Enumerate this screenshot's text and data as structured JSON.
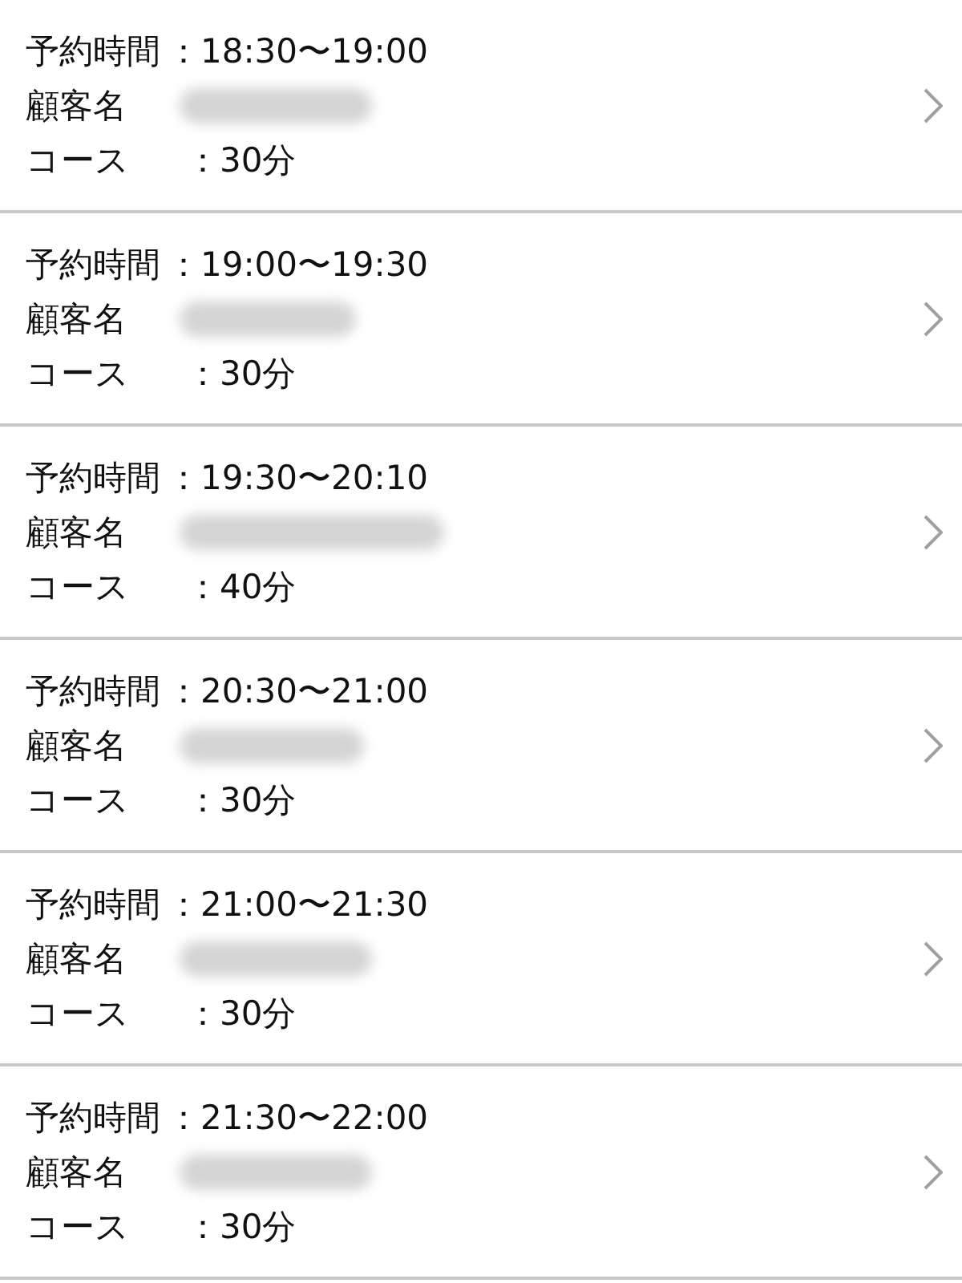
{
  "reservations": [
    {
      "time_label": "予約時間",
      "time": "：18:30〜19:00",
      "customer_label": "顧客名",
      "course_label": "コース",
      "course": "：30分"
    },
    {
      "time_label": "予約時間",
      "time": "：19:00〜19:30",
      "customer_label": "顧客名",
      "course_label": "コース",
      "course": "：30分"
    },
    {
      "time_label": "予約時間",
      "time": "：19:30〜20:10",
      "customer_label": "顧客名",
      "course_label": "コース",
      "course": "：40分"
    },
    {
      "time_label": "予約時間",
      "time": "：20:30〜21:00",
      "customer_label": "顧客名",
      "course_label": "コース",
      "course": "：30分"
    },
    {
      "time_label": "予約時間",
      "time": "：21:00〜21:30",
      "customer_label": "顧客名",
      "course_label": "コース",
      "course": "：30分"
    },
    {
      "time_label": "予約時間",
      "time": "：21:30〜22:00",
      "customer_label": "顧客名",
      "course_label": "コース",
      "course": "：30分"
    }
  ]
}
